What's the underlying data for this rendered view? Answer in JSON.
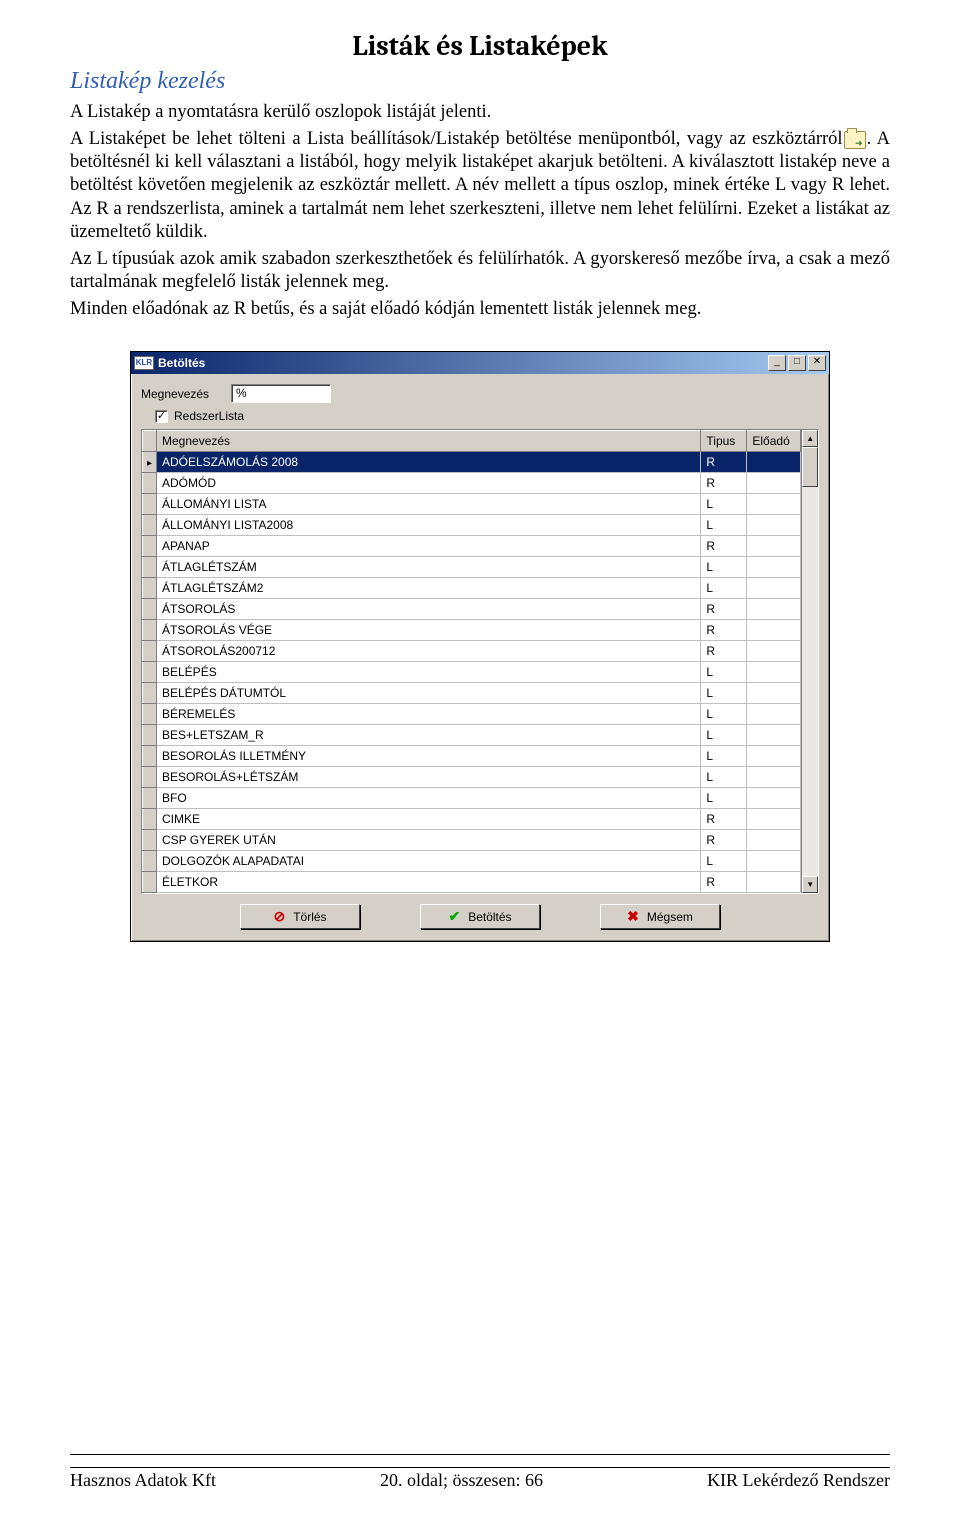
{
  "doc": {
    "main_heading": "Listák és Listaképek",
    "section_heading": "Listakép kezelés",
    "para1a": "A Listakép a nyomtatásra kerülő oszlopok listáját jelenti.",
    "para1b_pre": "A Listaképet be lehet tölteni a Lista beállítások/Listakép betöltése menüpontból, vagy az eszköztárról",
    "para1b_post": ". A betöltésnél ki kell választani a listából, hogy melyik listaképet akarjuk betölteni. A kiválasztott listakép neve a betöltést követően megjelenik az eszköztár mellett. A név mellett a típus oszlop, minek értéke L vagy R lehet. Az R a rendszerlista, aminek a tartalmát nem lehet szerkeszteni, illetve nem lehet felülírni. Ezeket a listákat az üzemeltető küldik.",
    "para2": "Az L típusúak azok amik szabadon szerkeszthetőek és felülírhatók. A gyorskereső mezőbe írva, a csak a mező tartalmának megfelelő listák jelennek meg.",
    "para3": "Minden előadónak az R betűs, és a saját előadó kódján lementett listák jelennek meg."
  },
  "dialog": {
    "app_icon_text": "KLR",
    "title": "Betöltés",
    "label_megnevezes": "Megnevezés",
    "input_value": "%",
    "checkbox_label": "RedszerLista",
    "checkbox_checked": true,
    "columns": {
      "megnevezes": "Megnevezés",
      "tipus": "Tipus",
      "eloado": "Előadó"
    },
    "rows": [
      {
        "name": "ADÓELSZÁMOLÁS 2008",
        "tipus": "R",
        "eloado": "",
        "selected": true
      },
      {
        "name": "ADÓMÓD",
        "tipus": "R",
        "eloado": ""
      },
      {
        "name": "ÁLLOMÁNYI LISTA",
        "tipus": "L",
        "eloado": ""
      },
      {
        "name": "ÁLLOMÁNYI LISTA2008",
        "tipus": "L",
        "eloado": ""
      },
      {
        "name": "APANAP",
        "tipus": "R",
        "eloado": ""
      },
      {
        "name": "ÁTLAGLÉTSZÁM",
        "tipus": "L",
        "eloado": ""
      },
      {
        "name": "ÁTLAGLÉTSZÁM2",
        "tipus": "L",
        "eloado": ""
      },
      {
        "name": "ÁTSOROLÁS",
        "tipus": "R",
        "eloado": ""
      },
      {
        "name": "ÁTSOROLÁS VÉGE",
        "tipus": "R",
        "eloado": ""
      },
      {
        "name": "ÁTSOROLÁS200712",
        "tipus": "R",
        "eloado": ""
      },
      {
        "name": "BELÉPÉS",
        "tipus": "L",
        "eloado": ""
      },
      {
        "name": "BELÉPÉS DÁTUMTÓL",
        "tipus": "L",
        "eloado": ""
      },
      {
        "name": "BÉREMELÉS",
        "tipus": "L",
        "eloado": ""
      },
      {
        "name": "BES+LETSZAM_R",
        "tipus": "L",
        "eloado": ""
      },
      {
        "name": "BESOROLÁS ILLETMÉNY",
        "tipus": "L",
        "eloado": ""
      },
      {
        "name": "BESOROLÁS+LÉTSZÁM",
        "tipus": "L",
        "eloado": ""
      },
      {
        "name": "BFO",
        "tipus": "L",
        "eloado": ""
      },
      {
        "name": "CIMKE",
        "tipus": "R",
        "eloado": ""
      },
      {
        "name": "CSP GYEREK UTÁN",
        "tipus": "R",
        "eloado": ""
      },
      {
        "name": "DOLGOZÓK ALAPADATAI",
        "tipus": "L",
        "eloado": ""
      },
      {
        "name": "ÉLETKOR",
        "tipus": "R",
        "eloado": ""
      }
    ],
    "buttons": {
      "delete": "Törlés",
      "load": "Betöltés",
      "cancel": "Mégsem"
    }
  },
  "footer": {
    "left": "Hasznos Adatok Kft",
    "center": "20. oldal; összesen: 66",
    "right": "KIR Lekérdező Rendszer"
  }
}
